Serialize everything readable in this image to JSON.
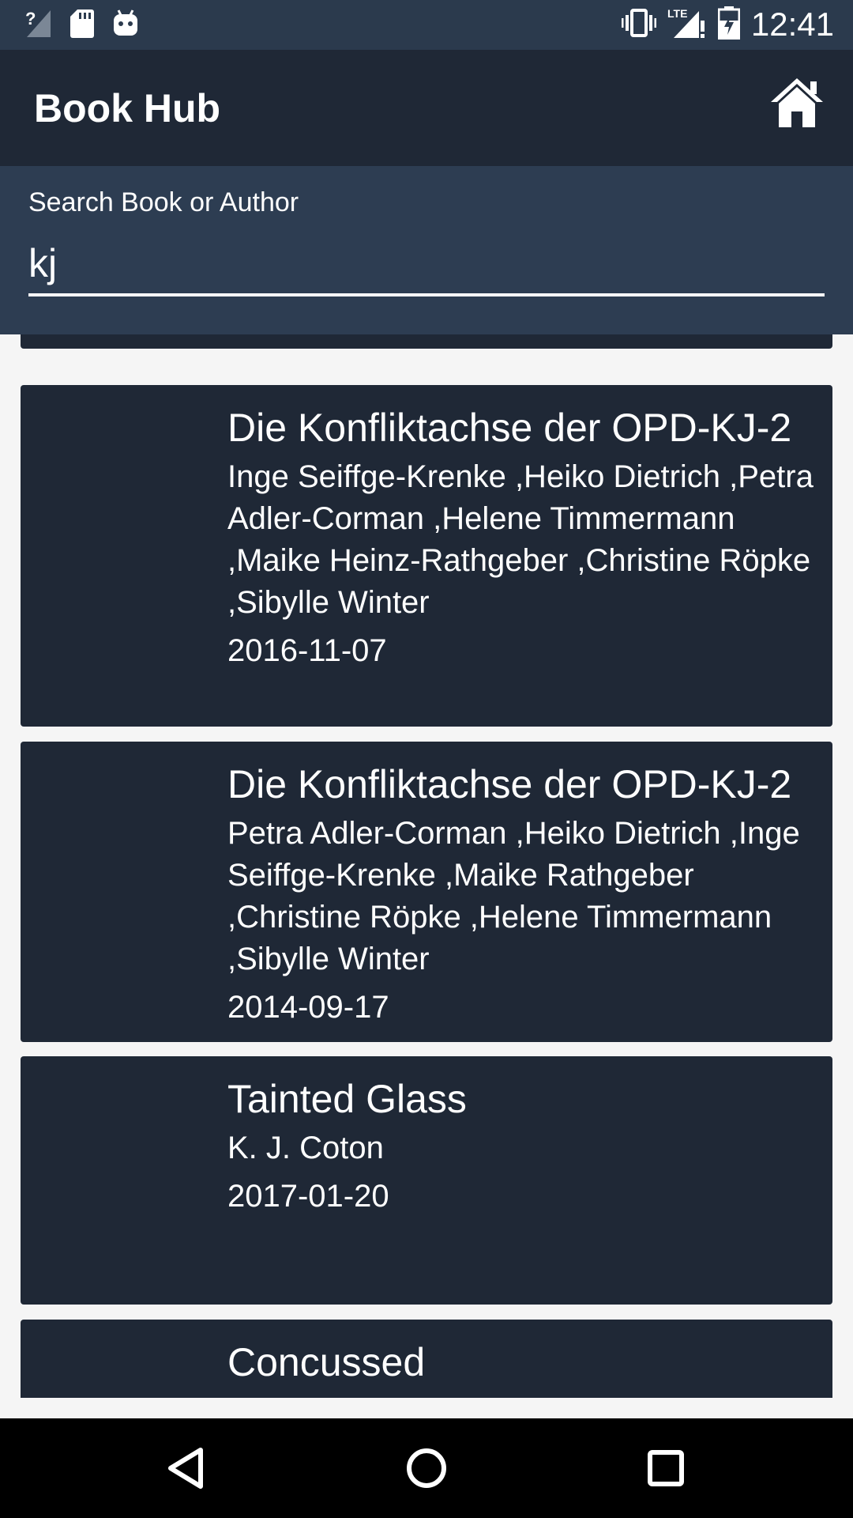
{
  "status_bar": {
    "time": "12:41",
    "icons": [
      "signal-unknown-icon",
      "sd-card-icon",
      "android-icon",
      "vibrate-icon",
      "lte-signal-icon",
      "battery-icon"
    ]
  },
  "app_bar": {
    "title": "Book Hub",
    "home_icon": "home-icon"
  },
  "search": {
    "label": "Search Book or Author",
    "value": "kj"
  },
  "books": [
    {
      "title": "Die Konfliktachse der OPD-KJ-2",
      "authors": "Inge Seiffge-Krenke ,Heiko Dietrich ,Petra Adler-Corman ,Helene Timmermann ,Maike Heinz-Rathgeber ,Christine Röpke ,Sibylle Winter",
      "date": "2016-11-07"
    },
    {
      "title": "Die Konfliktachse der OPD-KJ-2",
      "authors": "Petra Adler-Corman ,Heiko Dietrich ,Inge Seiffge-Krenke ,Maike Rathgeber ,Christine Röpke ,Helene Timmermann ,Sibylle Winter",
      "date": "2014-09-17"
    },
    {
      "title": "Tainted Glass",
      "authors": "K. J. Coton",
      "date": "2017-01-20"
    },
    {
      "title": "Concussed",
      "authors": "",
      "date": ""
    }
  ],
  "nav_bar": {
    "icons": [
      "back-icon",
      "home-circle-icon",
      "recents-icon"
    ]
  },
  "colors": {
    "status_bar": "#2b3a4d",
    "app_bar": "#1f2836",
    "search_area": "#2d3d52",
    "card": "#1f2836",
    "list_bg": "#f5f5f5"
  }
}
